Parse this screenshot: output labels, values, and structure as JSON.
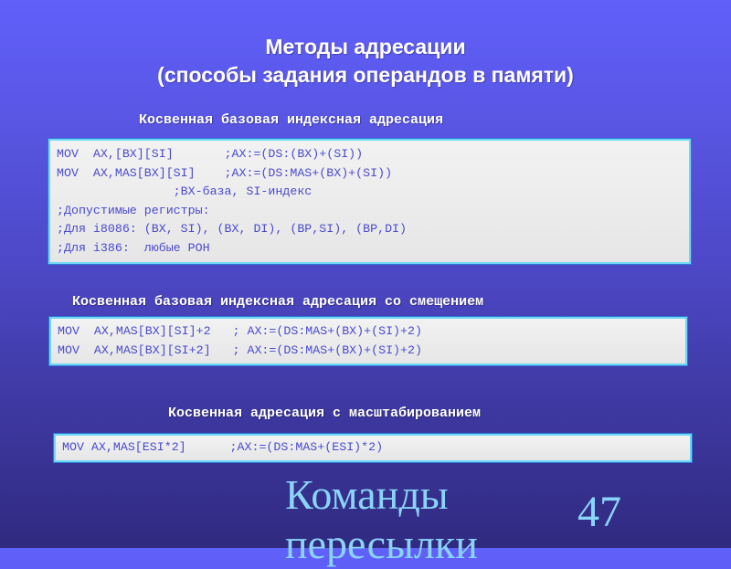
{
  "slide": {
    "title_line1": "Методы адресации",
    "title_line2": "(способы задания операндов в памяти)",
    "sections": [
      {
        "heading": "Косвенная базовая индексная адресация",
        "code_lines": [
          "MOV  AX,[BX][SI]       ;AX:=(DS:(BX)+(SI))",
          "MOV  AX,MAS[BX][SI]    ;AX:=(DS:MAS+(BX)+(SI))",
          "                ;BX-база, SI-индекс",
          ";Допустимые регистры:",
          ";Для i8086: (BX, SI), (BX, DI), (BP,SI), (BP,DI)",
          ";Для i386:  любые РОН"
        ]
      },
      {
        "heading": "Косвенная базовая индексная адресация со смещением",
        "code_lines": [
          "MOV  AX,MAS[BX][SI]+2   ; AX:=(DS:MAS+(BX)+(SI)+2)",
          "MOV  AX,MAS[BX][SI+2]   ; AX:=(DS:MAS+(BX)+(SI)+2)"
        ]
      },
      {
        "heading": "Косвенная адресация с масштабированием",
        "code_lines": [
          "MOV AX,MAS[ESI*2]      ;AX:=(DS:MAS+(ESI)*2)"
        ]
      }
    ],
    "footer_title_line1": "Команды",
    "footer_title_line2": "пересылки",
    "slide_number": "47"
  },
  "colors": {
    "background_top": "#6060fa",
    "background_bottom": "#302a80",
    "code_text": "#4a4acb",
    "box_border": "#6fd8f5",
    "footer_text": "#8ad4f8"
  }
}
